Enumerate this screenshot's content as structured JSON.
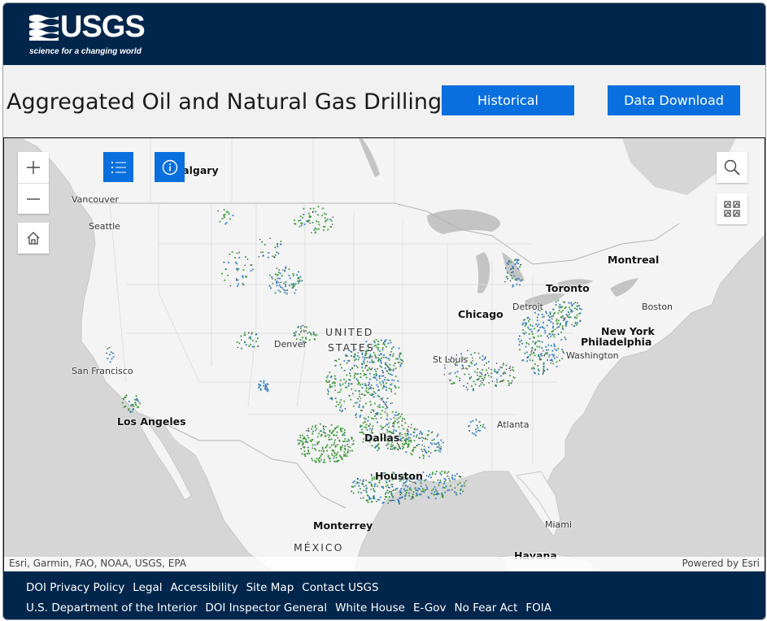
{
  "header": {
    "logo_text": "USGS",
    "tagline": "science for a changing world"
  },
  "title": "Aggregated Oil and Natural Gas Drilling",
  "buttons": {
    "historical": "Historical",
    "download": "Data Download"
  },
  "map": {
    "attribution": "Esri, Garmin, FAO, NOAA, USGS, EPA",
    "powered_by": "Powered by Esri",
    "controls": [
      "zoom-in-icon",
      "zoom-out-icon",
      "home-icon",
      "legend-list-icon",
      "info-icon",
      "search-icon",
      "basemap-gallery-icon"
    ],
    "labels": {
      "calgary": "Calgary",
      "vancouver": "Vancouver",
      "seattle": "Seattle",
      "montreal": "Montreal",
      "toronto": "Toronto",
      "boston": "Boston",
      "chicago": "Chicago",
      "detroit": "Detroit",
      "new_york": "New York",
      "philadelphia": "Philadelphia",
      "washington": "Washington",
      "united": "UNITED",
      "states": "STATES",
      "denver": "Denver",
      "st_louis": "St Louis",
      "san_francisco": "San Francisco",
      "los_angeles": "Los Angeles",
      "atlanta": "Atlanta",
      "dallas": "Dallas",
      "houston": "Houston",
      "miami": "Miami",
      "monterrey": "Monterrey",
      "mexico": "MÉXICO",
      "havana": "Havana"
    },
    "well_colors": {
      "oil": "#3a9c33",
      "gas": "#2f7bc4",
      "other": "#333333"
    }
  },
  "footer": {
    "row1": [
      "DOI Privacy Policy",
      "Legal",
      "Accessibility",
      "Site Map",
      "Contact USGS"
    ],
    "row2": [
      "U.S. Department of the Interior",
      "DOI Inspector General",
      "White House",
      "E-Gov",
      "No Fear Act",
      "FOIA"
    ]
  }
}
